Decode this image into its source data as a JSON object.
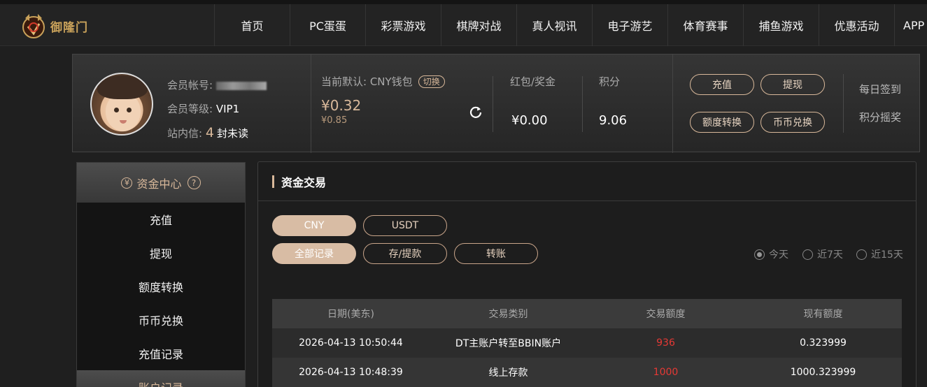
{
  "brand": {
    "logo_text": "御隆门"
  },
  "nav": [
    "首页",
    "PC蛋蛋",
    "彩票游戏",
    "棋牌对战",
    "真人视讯",
    "电子游艺",
    "体育赛事",
    "捕鱼游戏",
    "优惠活动",
    "APP"
  ],
  "user": {
    "account_label": "会员帐号:",
    "level_label": "会员等级:",
    "level_value": "VIP1",
    "msg_label": "站内信:",
    "msg_count": "4",
    "msg_unread": "封未读"
  },
  "wallet": {
    "label": "当前默认: CNY钱包",
    "switch_label": "切换",
    "balance": "¥0.32",
    "sub_balance": "¥0.85"
  },
  "stats": {
    "bonus_label": "红包/奖金",
    "bonus_value": "¥0.00",
    "points_label": "积分",
    "points_value": "9.06"
  },
  "actions": {
    "deposit": "充值",
    "withdraw": "提现",
    "transfer": "额度转换",
    "exchange": "币币兑换",
    "daily_checkin": "每日签到",
    "points_lottery": "积分摇奖"
  },
  "sidebar": {
    "title": "资金中心",
    "title_icon": "¥",
    "help_icon": "?",
    "items": [
      "充值",
      "提现",
      "额度转换",
      "币币兑换",
      "充值记录"
    ],
    "next_section": "账户记录"
  },
  "main": {
    "title": "资金交易",
    "currency_tabs": [
      "CNY",
      "USDT"
    ],
    "record_tabs": [
      "全部记录",
      "存/提款",
      "转账"
    ],
    "date_filters": [
      "今天",
      "近7天",
      "近15天"
    ],
    "table": {
      "headers": [
        "日期(美东)",
        "交易类别",
        "交易额度",
        "现有额度"
      ],
      "rows": [
        [
          "2026-04-13 10:50:44",
          "DT主账户转至BBIN账户",
          "936",
          "0.323999"
        ],
        [
          "2026-04-13 10:48:39",
          "线上存款",
          "1000",
          "1000.323999"
        ]
      ]
    }
  },
  "colors": {
    "accent": "#d8b89a",
    "amount": "#e53935"
  }
}
